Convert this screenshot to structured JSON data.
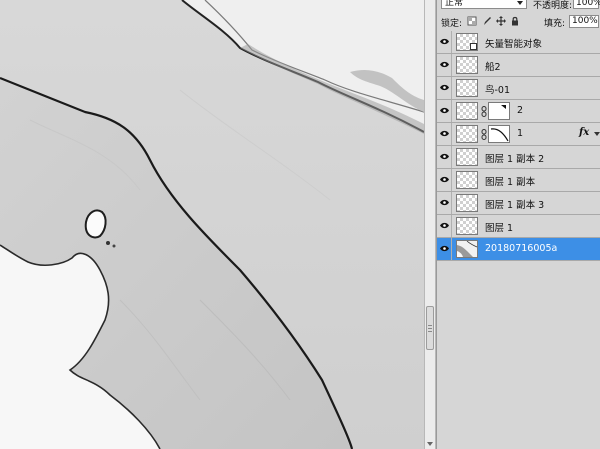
{
  "layers_panel": {
    "blend_mode": "正常",
    "opacity_label": "不透明度:",
    "opacity_value": "100%",
    "lock_label": "锁定:",
    "fill_label": "填充:",
    "fill_value": "100%",
    "layers": [
      {
        "name": "矢量智能对象",
        "visible": true,
        "selected": false,
        "type": "smart-object"
      },
      {
        "name": "船2",
        "visible": true,
        "selected": false,
        "type": "normal"
      },
      {
        "name": "鸟-01",
        "visible": true,
        "selected": false,
        "type": "normal"
      },
      {
        "name": "2",
        "visible": true,
        "selected": false,
        "type": "masked"
      },
      {
        "name": "1",
        "visible": true,
        "selected": false,
        "type": "masked",
        "fx": "fx"
      },
      {
        "name": "图层 1 副本 2",
        "visible": true,
        "selected": false,
        "type": "normal"
      },
      {
        "name": "图层 1 副本",
        "visible": true,
        "selected": false,
        "type": "normal"
      },
      {
        "name": "图层 1 副本 3",
        "visible": true,
        "selected": false,
        "type": "normal"
      },
      {
        "name": "图层 1",
        "visible": true,
        "selected": false,
        "type": "normal"
      },
      {
        "name": "20180716005a",
        "visible": true,
        "selected": true,
        "type": "photo"
      }
    ]
  },
  "colors": {
    "selection": "#3d8fe6",
    "panel_bg": "#d6d6d6",
    "canvas_bg": "#f6f6f6"
  }
}
